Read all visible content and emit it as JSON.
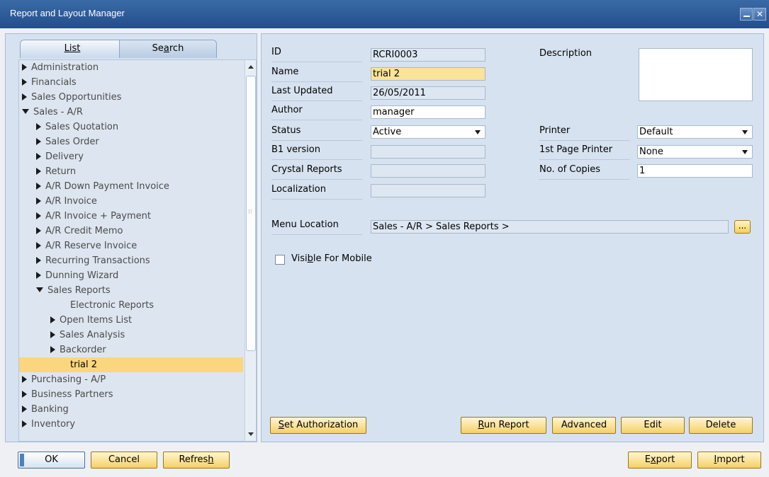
{
  "window": {
    "title": "Report and Layout Manager"
  },
  "tabs": {
    "list": "List",
    "search_pre": "Se",
    "search_u": "a",
    "search_post": "rch"
  },
  "tree": [
    {
      "label": "Administration",
      "state": "collapsed",
      "indent": 0
    },
    {
      "label": "Financials",
      "state": "collapsed",
      "indent": 0
    },
    {
      "label": "Sales Opportunities",
      "state": "collapsed",
      "indent": 0
    },
    {
      "label": "Sales - A/R",
      "state": "expanded",
      "indent": 0
    },
    {
      "label": "Sales Quotation",
      "state": "collapsed",
      "indent": 1
    },
    {
      "label": "Sales Order",
      "state": "collapsed",
      "indent": 1
    },
    {
      "label": "Delivery",
      "state": "collapsed",
      "indent": 1
    },
    {
      "label": "Return",
      "state": "collapsed",
      "indent": 1
    },
    {
      "label": "A/R Down Payment Invoice",
      "state": "collapsed",
      "indent": 1
    },
    {
      "label": "A/R Invoice",
      "state": "collapsed",
      "indent": 1
    },
    {
      "label": "A/R Invoice + Payment",
      "state": "collapsed",
      "indent": 1
    },
    {
      "label": "A/R Credit Memo",
      "state": "collapsed",
      "indent": 1
    },
    {
      "label": "A/R Reserve Invoice",
      "state": "collapsed",
      "indent": 1
    },
    {
      "label": "Recurring Transactions",
      "state": "collapsed",
      "indent": 1
    },
    {
      "label": "Dunning Wizard",
      "state": "collapsed",
      "indent": 1
    },
    {
      "label": "Sales Reports",
      "state": "expanded",
      "indent": 1
    },
    {
      "label": "Electronic Reports",
      "state": "leaf",
      "indent": 2
    },
    {
      "label": "Open Items List",
      "state": "collapsed",
      "indent": 2
    },
    {
      "label": "Sales Analysis",
      "state": "collapsed",
      "indent": 2
    },
    {
      "label": "Backorder",
      "state": "collapsed",
      "indent": 2
    },
    {
      "label": "trial 2",
      "state": "leaf",
      "indent": 2,
      "selected": true
    },
    {
      "label": "Purchasing - A/P",
      "state": "collapsed",
      "indent": 0
    },
    {
      "label": "Business Partners",
      "state": "collapsed",
      "indent": 0
    },
    {
      "label": "Banking",
      "state": "collapsed",
      "indent": 0
    },
    {
      "label": "Inventory",
      "state": "collapsed",
      "indent": 0
    }
  ],
  "form": {
    "id_label": "ID",
    "id_value": "RCRI0003",
    "name_label": "Name",
    "name_value": "trial 2",
    "last_updated_label": "Last Updated",
    "last_updated_value": "26/05/2011",
    "author_label": "Author",
    "author_value": "manager",
    "status_label": "Status",
    "status_value": "Active",
    "b1_version_label": "B1 version",
    "b1_version_value": "",
    "crystal_reports_label": "Crystal Reports",
    "crystal_reports_value": "",
    "localization_label": "Localization",
    "localization_value": "",
    "description_label": "Description",
    "printer_label": "Printer",
    "printer_value": "Default",
    "first_page_printer_label": "1st Page Printer",
    "first_page_printer_value": "None",
    "copies_label": "No. of Copies",
    "copies_value": "1",
    "menu_location_label": "Menu Location",
    "menu_location_value": "Sales - A/R > Sales Reports >",
    "ellipsis": "...",
    "visible_mobile_pre": "Visi",
    "visible_mobile_u": "b",
    "visible_mobile_post": "le For Mobile"
  },
  "buttons": {
    "set_auth_u": "S",
    "set_auth_rest": "et Authorization",
    "run_report_u": "R",
    "run_report_rest": "un Report",
    "advanced": "Advanced",
    "edit": "Edit",
    "delete": "Delete",
    "ok": "OK",
    "cancel": "Cancel",
    "refresh_pre": "Refres",
    "refresh_u": "h",
    "export_pre": "E",
    "export_u": "x",
    "export_post": "port",
    "import_u": "I",
    "import_rest": "mport"
  }
}
